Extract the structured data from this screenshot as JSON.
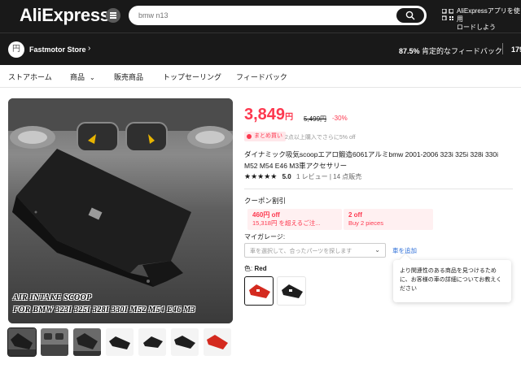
{
  "header": {
    "logo": "AliExpress",
    "search_placeholder": "bmw n13",
    "app_text_line1": "AliExpressアプリを使用",
    "app_text_line2": "ロードしよう"
  },
  "store": {
    "avatar_glyph": "円",
    "name": "Fastmotor Store",
    "feedback_pct": "87.5%",
    "feedback_label": " 肯定的なフィードバック",
    "followers": "179"
  },
  "nav": {
    "items": [
      "ストアホーム",
      "商品",
      "販売商品",
      "トップセーリング",
      "フィードバック"
    ]
  },
  "product": {
    "image_caption_line1": "AIR INTAKE SCOOP",
    "image_caption_line2": "FOR BMW 323I 325I 328I 330I M52 M54 E46 M3",
    "price": "3,849",
    "price_unit": "円",
    "original_price": "5,499円",
    "discount": "-30%",
    "badge": "まとめ買い",
    "promo": "2点以上購入でさらに5% off",
    "title": "ダイナミック吸気scoopエアロ鍛造6061アルミbmw 2001-2006 323i 325i 328i 330i M52 M54 E46 M3車アクセサリー",
    "rating_value": "5.0",
    "reviews": "1 レビュー",
    "sold": "14 点販売",
    "coupon_label": "クーポン割引",
    "coupons": [
      {
        "title": "460円 off",
        "detail": "15,318円 を超えるご注..."
      },
      {
        "title": "2 off",
        "detail": "Buy 2 pieces"
      }
    ],
    "garage_label": "マイガレージ:",
    "garage_placeholder": "車を選択して、合ったパーツを探します",
    "add_car": "車を追加",
    "tooltip": "より関連性のある商品を見つけるために、お客様の車の詳細についてお教えください",
    "color_label": "色:",
    "color_value": "Red"
  },
  "colors": {
    "accent": "#fd384f",
    "header_bg": "#191919",
    "link": "#2e6fd8"
  }
}
